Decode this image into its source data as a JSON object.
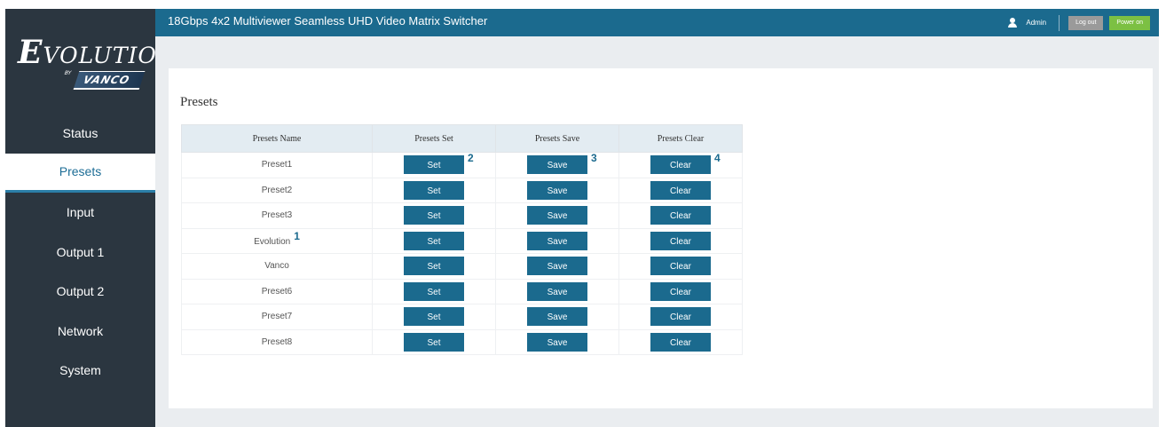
{
  "app": {
    "title": "18Gbps 4x2 Multiviewer Seamless UHD Video Matrix Switcher",
    "brand": {
      "main_first": "E",
      "main_rest": "VOLUTION",
      "sub": "VANCO",
      "sub_prefix": "BY"
    },
    "colors": {
      "header": "#1b6a8e",
      "sidebar": "#2b3640",
      "button": "#1b6a8e",
      "logout": "#9a9a9a",
      "power": "#7cc043"
    }
  },
  "header": {
    "user_icon": "user-icon",
    "user": "Admin",
    "logout": "Log out",
    "power": "Power on"
  },
  "sidebar": {
    "items": [
      {
        "label": "Status",
        "active": false
      },
      {
        "label": "Presets",
        "active": true
      },
      {
        "label": "Input",
        "active": false
      },
      {
        "label": "Output 1",
        "active": false
      },
      {
        "label": "Output 2",
        "active": false
      },
      {
        "label": "Network",
        "active": false
      },
      {
        "label": "System",
        "active": false
      }
    ]
  },
  "main": {
    "title": "Presets",
    "table": {
      "headers": [
        "Presets Name",
        "Presets Set",
        "Presets Save",
        "Presets Clear"
      ],
      "button_labels": {
        "set": "Set",
        "save": "Save",
        "clear": "Clear"
      },
      "rows": [
        {
          "name": "Preset1"
        },
        {
          "name": "Preset2"
        },
        {
          "name": "Preset3"
        },
        {
          "name": "Evolution"
        },
        {
          "name": "Vanco"
        },
        {
          "name": "Preset6"
        },
        {
          "name": "Preset7"
        },
        {
          "name": "Preset8"
        }
      ]
    },
    "callouts": {
      "name": "1",
      "set": "2",
      "save": "3",
      "clear": "4"
    }
  }
}
